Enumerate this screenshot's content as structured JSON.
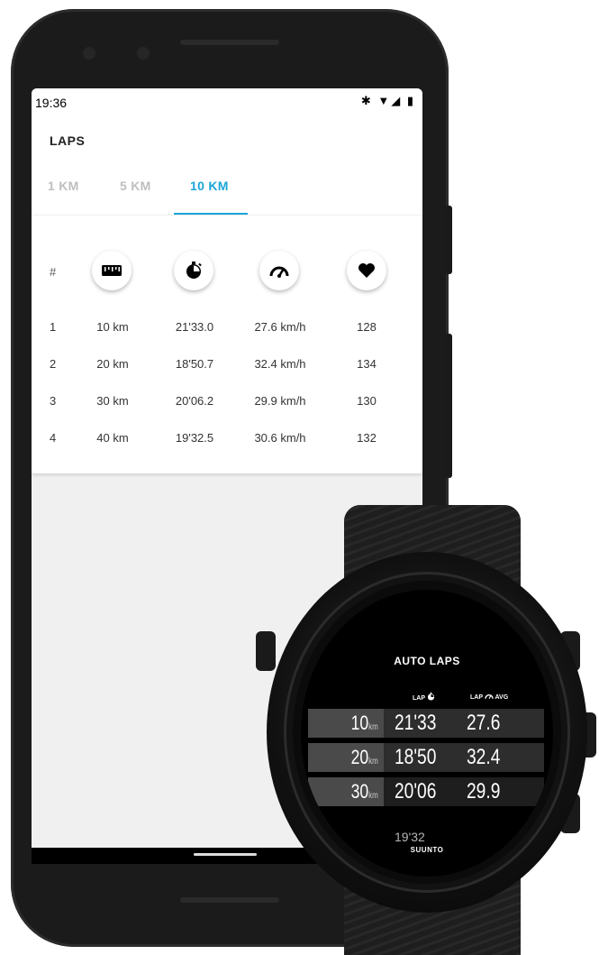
{
  "status_bar": {
    "time": "19:36",
    "icons": "✱ ▼◢ ▮"
  },
  "screen": {
    "title": "LAPS",
    "tabs": [
      {
        "label": "1 KM",
        "active": false
      },
      {
        "label": "5 KM",
        "active": false
      },
      {
        "label": "10 KM",
        "active": true
      }
    ],
    "accent_color": "#1ca6d9",
    "table": {
      "hash": "#",
      "column_icons": [
        "distance-icon",
        "duration-icon",
        "speed-icon",
        "heart-icon"
      ],
      "rows": [
        {
          "num": "1",
          "distance": "10 km",
          "duration": "21'33.0",
          "speed": "27.6 km/h",
          "hr": "128"
        },
        {
          "num": "2",
          "distance": "20 km",
          "duration": "18'50.7",
          "speed": "32.4 km/h",
          "hr": "134"
        },
        {
          "num": "3",
          "distance": "30 km",
          "duration": "20'06.2",
          "speed": "29.9 km/h",
          "hr": "130"
        },
        {
          "num": "4",
          "distance": "40 km",
          "duration": "19'32.5",
          "speed": "30.6 km/h",
          "hr": "132"
        }
      ]
    }
  },
  "watch": {
    "title": "AUTO LAPS",
    "hdr_lap": "LAP",
    "hdr_lap2": "LAP",
    "hdr_avg": "AVG",
    "rows": [
      {
        "km": "10",
        "unit": "km",
        "time": "21'33",
        "avg": "27.6"
      },
      {
        "km": "20",
        "unit": "km",
        "time": "18'50",
        "avg": "32.4"
      },
      {
        "km": "30",
        "unit": "km",
        "time": "20'06",
        "avg": "29.9"
      }
    ],
    "partial": "19'32",
    "brand": "SUUNTO"
  }
}
